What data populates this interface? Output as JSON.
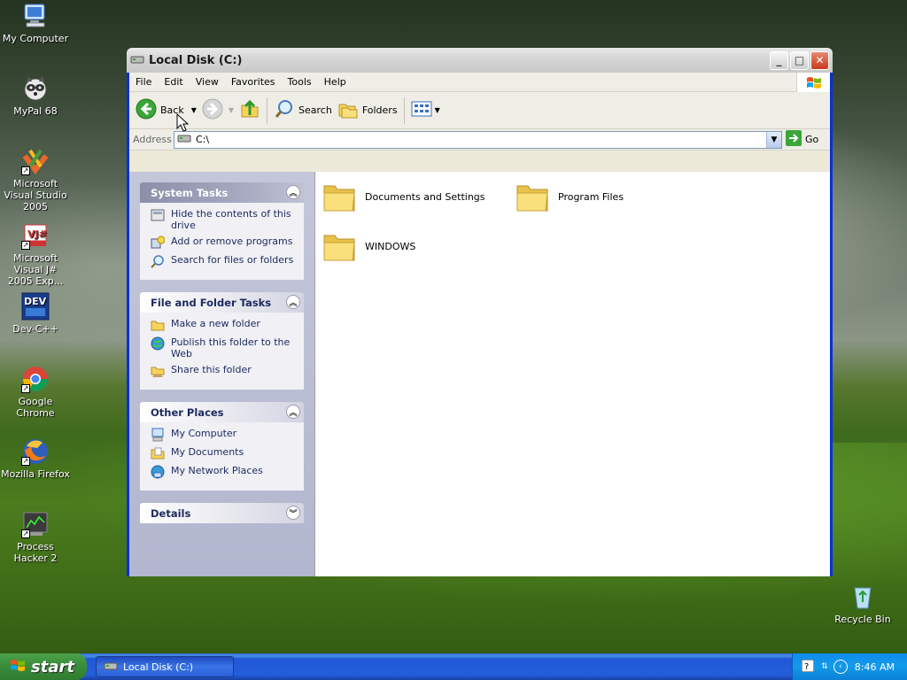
{
  "desktop": {
    "icons": [
      {
        "label": "My Computer"
      },
      {
        "label": "MyPal 68"
      },
      {
        "label": "Microsoft Visual Studio 2005"
      },
      {
        "label": "Microsoft Visual J# 2005 Exp..."
      },
      {
        "label": "Dev-C++"
      },
      {
        "label": "Google Chrome"
      },
      {
        "label": "Mozilla Firefox"
      },
      {
        "label": "Process Hacker 2"
      },
      {
        "label": "Recycle Bin"
      }
    ]
  },
  "window": {
    "title": "Local Disk (C:)",
    "menu": [
      "File",
      "Edit",
      "View",
      "Favorites",
      "Tools",
      "Help"
    ],
    "toolbar": {
      "back": "Back",
      "search": "Search",
      "folders": "Folders"
    },
    "address": {
      "label": "Address",
      "value": "C:\\",
      "go": "Go"
    },
    "taskpane": {
      "system_tasks": {
        "title": "System Tasks",
        "items": [
          "Hide the contents of this drive",
          "Add or remove programs",
          "Search for files or folders"
        ]
      },
      "file_folder_tasks": {
        "title": "File and Folder Tasks",
        "items": [
          "Make a new folder",
          "Publish this folder to the Web",
          "Share this folder"
        ]
      },
      "other_places": {
        "title": "Other Places",
        "items": [
          "My Computer",
          "My Documents",
          "My Network Places"
        ]
      },
      "details": {
        "title": "Details"
      }
    },
    "files": [
      "Documents and Settings",
      "Program Files",
      "WINDOWS"
    ]
  },
  "taskbar": {
    "start": "start",
    "task": "Local Disk (C:)",
    "clock": "8:46 AM"
  },
  "colors": {
    "title_blue": "#0831d9",
    "taskbar_blue": "#245edb",
    "start_green": "#3c8f3c"
  }
}
